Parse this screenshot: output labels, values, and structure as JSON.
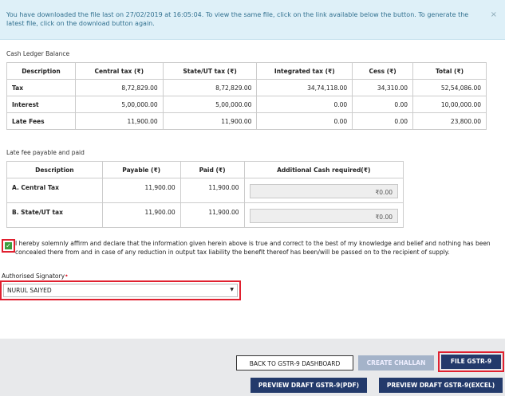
{
  "alert": {
    "message": "You have downloaded the file last on 27/02/2019 at 16:05:04. To view the same file, click on the link available below the button. To generate the latest file, click on the download button again.",
    "close": "×"
  },
  "ledger": {
    "title": "Cash Ledger Balance",
    "headers": [
      "Description",
      "Central tax (₹)",
      "State/UT tax (₹)",
      "Integrated tax (₹)",
      "Cess (₹)",
      "Total (₹)"
    ],
    "rows": [
      [
        "Tax",
        "8,72,829.00",
        "8,72,829.00",
        "34,74,118.00",
        "34,310.00",
        "52,54,086.00"
      ],
      [
        "Interest",
        "5,00,000.00",
        "5,00,000.00",
        "0.00",
        "0.00",
        "10,00,000.00"
      ],
      [
        "Late Fees",
        "11,900.00",
        "11,900.00",
        "0.00",
        "0.00",
        "23,800.00"
      ]
    ]
  },
  "latefee": {
    "title": "Late fee payable and paid",
    "headers": [
      "Description",
      "Payable (₹)",
      "Paid (₹)",
      "Additional Cash required(₹)"
    ],
    "rows": [
      [
        "A. Central Tax",
        "11,900.00",
        "11,900.00",
        "₹0.00"
      ],
      [
        "B. State/UT tax",
        "11,900.00",
        "11,900.00",
        "₹0.00"
      ]
    ]
  },
  "declaration": {
    "checked": true,
    "check_mark": "✓",
    "text": "I hereby solemnly affirm and declare that the information given herein above is true and correct to the best of my knowledge and belief and nothing has been concealed there from and in case of any reduction in output tax liability the benefit thereof has been/will be passed on to the recipient of supply."
  },
  "signatory": {
    "label": "Authorised Signatory",
    "required_mark": "•",
    "selected": "NURUL SAIYED",
    "caret": "▼"
  },
  "buttons": {
    "back": "BACK TO GSTR-9 DASHBOARD",
    "challan": "CREATE CHALLAN",
    "file": "FILE GSTR-9",
    "preview_pdf": "PREVIEW DRAFT GSTR-9(PDF)",
    "preview_excel": "PREVIEW DRAFT GSTR-9(EXCEL)"
  },
  "colors": {
    "primary": "#233a6b",
    "disabled": "#a4b3c9",
    "highlight": "#e0202f",
    "check": "#3a9d3e",
    "alert_bg": "#def0f8"
  }
}
